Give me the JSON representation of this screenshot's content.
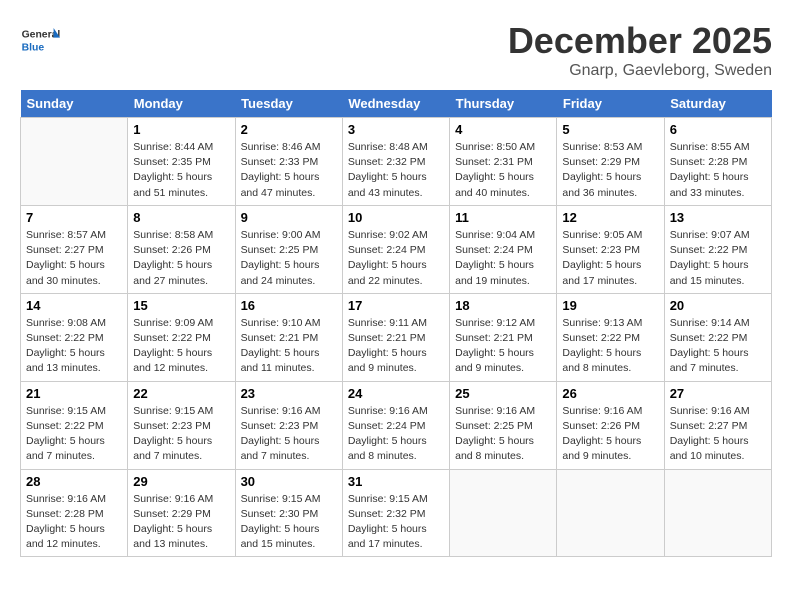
{
  "header": {
    "logo_general": "General",
    "logo_blue": "Blue",
    "month_title": "December 2025",
    "location": "Gnarp, Gaevleborg, Sweden"
  },
  "days_of_week": [
    "Sunday",
    "Monday",
    "Tuesday",
    "Wednesday",
    "Thursday",
    "Friday",
    "Saturday"
  ],
  "weeks": [
    [
      {
        "day": "",
        "info": ""
      },
      {
        "day": "1",
        "info": "Sunrise: 8:44 AM\nSunset: 2:35 PM\nDaylight: 5 hours\nand 51 minutes."
      },
      {
        "day": "2",
        "info": "Sunrise: 8:46 AM\nSunset: 2:33 PM\nDaylight: 5 hours\nand 47 minutes."
      },
      {
        "day": "3",
        "info": "Sunrise: 8:48 AM\nSunset: 2:32 PM\nDaylight: 5 hours\nand 43 minutes."
      },
      {
        "day": "4",
        "info": "Sunrise: 8:50 AM\nSunset: 2:31 PM\nDaylight: 5 hours\nand 40 minutes."
      },
      {
        "day": "5",
        "info": "Sunrise: 8:53 AM\nSunset: 2:29 PM\nDaylight: 5 hours\nand 36 minutes."
      },
      {
        "day": "6",
        "info": "Sunrise: 8:55 AM\nSunset: 2:28 PM\nDaylight: 5 hours\nand 33 minutes."
      }
    ],
    [
      {
        "day": "7",
        "info": "Sunrise: 8:57 AM\nSunset: 2:27 PM\nDaylight: 5 hours\nand 30 minutes."
      },
      {
        "day": "8",
        "info": "Sunrise: 8:58 AM\nSunset: 2:26 PM\nDaylight: 5 hours\nand 27 minutes."
      },
      {
        "day": "9",
        "info": "Sunrise: 9:00 AM\nSunset: 2:25 PM\nDaylight: 5 hours\nand 24 minutes."
      },
      {
        "day": "10",
        "info": "Sunrise: 9:02 AM\nSunset: 2:24 PM\nDaylight: 5 hours\nand 22 minutes."
      },
      {
        "day": "11",
        "info": "Sunrise: 9:04 AM\nSunset: 2:24 PM\nDaylight: 5 hours\nand 19 minutes."
      },
      {
        "day": "12",
        "info": "Sunrise: 9:05 AM\nSunset: 2:23 PM\nDaylight: 5 hours\nand 17 minutes."
      },
      {
        "day": "13",
        "info": "Sunrise: 9:07 AM\nSunset: 2:22 PM\nDaylight: 5 hours\nand 15 minutes."
      }
    ],
    [
      {
        "day": "14",
        "info": "Sunrise: 9:08 AM\nSunset: 2:22 PM\nDaylight: 5 hours\nand 13 minutes."
      },
      {
        "day": "15",
        "info": "Sunrise: 9:09 AM\nSunset: 2:22 PM\nDaylight: 5 hours\nand 12 minutes."
      },
      {
        "day": "16",
        "info": "Sunrise: 9:10 AM\nSunset: 2:21 PM\nDaylight: 5 hours\nand 11 minutes."
      },
      {
        "day": "17",
        "info": "Sunrise: 9:11 AM\nSunset: 2:21 PM\nDaylight: 5 hours\nand 9 minutes."
      },
      {
        "day": "18",
        "info": "Sunrise: 9:12 AM\nSunset: 2:21 PM\nDaylight: 5 hours\nand 9 minutes."
      },
      {
        "day": "19",
        "info": "Sunrise: 9:13 AM\nSunset: 2:22 PM\nDaylight: 5 hours\nand 8 minutes."
      },
      {
        "day": "20",
        "info": "Sunrise: 9:14 AM\nSunset: 2:22 PM\nDaylight: 5 hours\nand 7 minutes."
      }
    ],
    [
      {
        "day": "21",
        "info": "Sunrise: 9:15 AM\nSunset: 2:22 PM\nDaylight: 5 hours\nand 7 minutes."
      },
      {
        "day": "22",
        "info": "Sunrise: 9:15 AM\nSunset: 2:23 PM\nDaylight: 5 hours\nand 7 minutes."
      },
      {
        "day": "23",
        "info": "Sunrise: 9:16 AM\nSunset: 2:23 PM\nDaylight: 5 hours\nand 7 minutes."
      },
      {
        "day": "24",
        "info": "Sunrise: 9:16 AM\nSunset: 2:24 PM\nDaylight: 5 hours\nand 8 minutes."
      },
      {
        "day": "25",
        "info": "Sunrise: 9:16 AM\nSunset: 2:25 PM\nDaylight: 5 hours\nand 8 minutes."
      },
      {
        "day": "26",
        "info": "Sunrise: 9:16 AM\nSunset: 2:26 PM\nDaylight: 5 hours\nand 9 minutes."
      },
      {
        "day": "27",
        "info": "Sunrise: 9:16 AM\nSunset: 2:27 PM\nDaylight: 5 hours\nand 10 minutes."
      }
    ],
    [
      {
        "day": "28",
        "info": "Sunrise: 9:16 AM\nSunset: 2:28 PM\nDaylight: 5 hours\nand 12 minutes."
      },
      {
        "day": "29",
        "info": "Sunrise: 9:16 AM\nSunset: 2:29 PM\nDaylight: 5 hours\nand 13 minutes."
      },
      {
        "day": "30",
        "info": "Sunrise: 9:15 AM\nSunset: 2:30 PM\nDaylight: 5 hours\nand 15 minutes."
      },
      {
        "day": "31",
        "info": "Sunrise: 9:15 AM\nSunset: 2:32 PM\nDaylight: 5 hours\nand 17 minutes."
      },
      {
        "day": "",
        "info": ""
      },
      {
        "day": "",
        "info": ""
      },
      {
        "day": "",
        "info": ""
      }
    ]
  ]
}
